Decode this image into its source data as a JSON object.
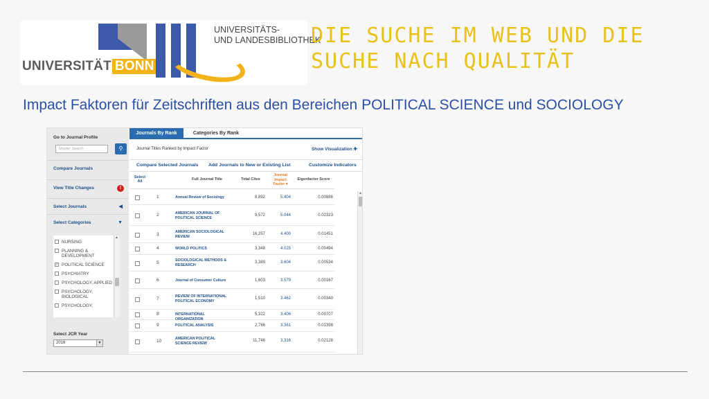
{
  "logos": {
    "uni_text": "UNIVERSITÄT",
    "uni_bonn": "BONN",
    "ulb_line1": "UNIVERSITÄTS-",
    "ulb_line2": "UND LANDESBIBLIOTHEK"
  },
  "slide": {
    "title_line1": "DIE SUCHE IM WEB UND DIE",
    "title_line2": "SUCHE NACH QUALITÄT",
    "subtitle": "Impact Faktoren für Zeitschriften aus den Bereichen POLITICAL SCIENCE und SOCIOLOGY"
  },
  "sidebar": {
    "go_to_profile": "Go to Journal Profile",
    "search_placeholder": "Master Search",
    "compare_journals": "Compare Journals",
    "view_title_changes": "View Title Changes",
    "select_journals": "Select Journals",
    "select_categories": "Select Categories",
    "categories": [
      {
        "label": "NURSING",
        "checked": false
      },
      {
        "label": "PLANNING & DEVELOPMENT",
        "checked": false
      },
      {
        "label": "POLITICAL SCIENCE",
        "checked": true
      },
      {
        "label": "PSYCHIATRY",
        "checked": false
      },
      {
        "label": "PSYCHOLOGY, APPLIED",
        "checked": false
      },
      {
        "label": "PSYCHOLOGY, BIOLOGICAL",
        "checked": false
      },
      {
        "label": "PSYCHOLOGY,",
        "checked": false
      }
    ],
    "select_year_label": "Select JCR Year",
    "selected_year": "2016"
  },
  "main": {
    "tab_active": "Journals By Rank",
    "tab_inactive": "Categories By Rank",
    "list_title": "Journal Titles Ranked by Impact Factor",
    "show_visualization": "Show Visualization",
    "compare_selected": "Compare Selected Journals",
    "add_journals": "Add Journals to New or Existing List",
    "customize": "Customize Indicators",
    "headers": {
      "select_all_1": "Select",
      "select_all_2": "All",
      "full_title": "Full Journal Title",
      "total_cites": "Total Cites",
      "jif_1": "Journal",
      "jif_2": "Impact",
      "jif_3": "Factor",
      "eigenfactor": "Eigenfactor Score"
    },
    "rows": [
      {
        "rank": "1",
        "title": "Annual Review of Sociology",
        "cites": "8,892",
        "jif": "5.404",
        "eig": "0.00886"
      },
      {
        "rank": "2",
        "title": "AMERICAN JOURNAL OF POLITICAL SCIENCE",
        "cites": "9,572",
        "jif": "5.044",
        "eig": "0.02323"
      },
      {
        "rank": "3",
        "title": "AMERICAN SOCIOLOGICAL REVIEW",
        "cites": "16,257",
        "jif": "4.400",
        "eig": "0.01451"
      },
      {
        "rank": "4",
        "title": "WORLD POLITICS",
        "cites": "3,348",
        "jif": "4.025",
        "eig": "0.00494"
      },
      {
        "rank": "5",
        "title": "SOCIOLOGICAL METHODS & RESEARCH",
        "cites": "3,389",
        "jif": "3.604",
        "eig": "0.00534"
      },
      {
        "rank": "6",
        "title": "Journal of Consumer Culture",
        "cites": "1,603",
        "jif": "3.579",
        "eig": "0.00167"
      },
      {
        "rank": "7",
        "title": "REVIEW OF INTERNATIONAL POLITICAL ECONOMY",
        "cites": "1,510",
        "jif": "3.462",
        "eig": "0.00340"
      },
      {
        "rank": "8",
        "title": "INTERNATIONAL ORGANIZATION",
        "cites": "5,322",
        "jif": "3.406",
        "eig": "0.00707"
      },
      {
        "rank": "9",
        "title": "POLITICAL ANALYSIS",
        "cites": "2,766",
        "jif": "3.361",
        "eig": "0.01398"
      },
      {
        "rank": "10",
        "title": "AMERICAN POLITICAL SCIENCE REVIEW",
        "cites": "11,746",
        "jif": "3.316",
        "eig": "0.02128"
      }
    ]
  },
  "colors": {
    "title_yellow": "#e8c21a",
    "subtitle_blue": "#2b4fa5",
    "link_blue": "#1d4f8a",
    "tab_blue": "#2a6cb0",
    "uni_gold": "#f2b21a"
  }
}
